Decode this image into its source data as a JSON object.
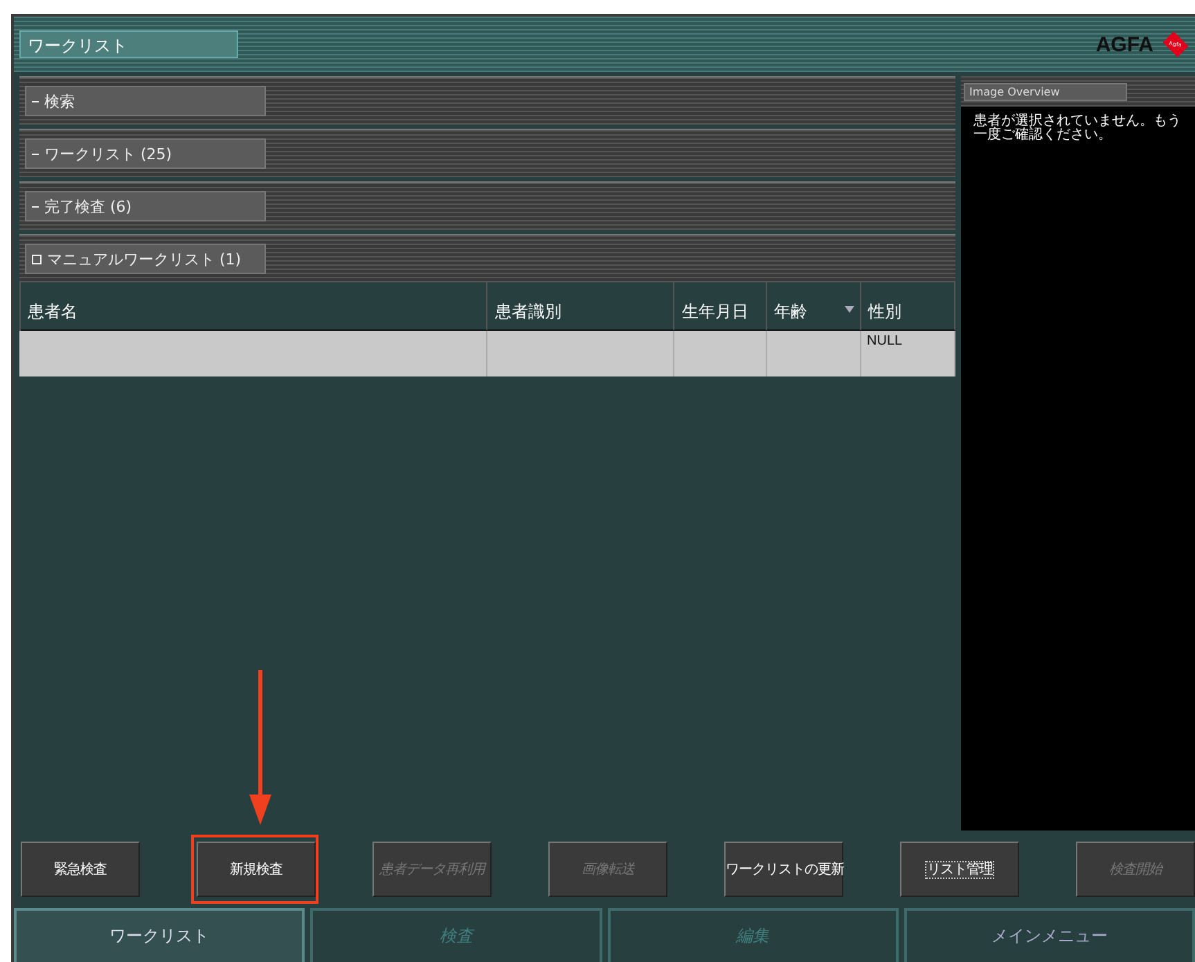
{
  "window": {
    "title": "ワークリスト",
    "logo": "AGFA",
    "logo_badge": "Agfa"
  },
  "sections": [
    {
      "label": "検索",
      "expanded": true
    },
    {
      "label": "ワークリスト (25)",
      "expanded": true
    },
    {
      "label": "完了検査 (6)",
      "expanded": true
    },
    {
      "label": "マニュアルワークリスト (1)",
      "expanded": false
    }
  ],
  "table": {
    "columns": [
      {
        "label": "患者名",
        "sorted": false
      },
      {
        "label": "患者識別",
        "sorted": false
      },
      {
        "label": "生年月日",
        "sorted": false
      },
      {
        "label": "年齢",
        "sorted": true
      },
      {
        "label": "性別",
        "sorted": false
      }
    ],
    "rows": [
      {
        "cells": [
          null,
          null,
          null,
          null,
          "NULL"
        ]
      }
    ]
  },
  "image_overview": {
    "title": "Image Overview",
    "message": "患者が選択されていません。もう一度ご確認ください。"
  },
  "buttons": [
    {
      "label": "緊急検査",
      "disabled": false,
      "highlighted": false,
      "focused": false
    },
    {
      "label": "新規検査",
      "disabled": false,
      "highlighted": true,
      "focused": false
    },
    {
      "label": "患者データ再利用",
      "disabled": true,
      "highlighted": false,
      "focused": false
    },
    {
      "label": "画像転送",
      "disabled": true,
      "highlighted": false,
      "focused": false
    },
    {
      "label": "ワークリストの更新",
      "disabled": false,
      "highlighted": false,
      "focused": false
    },
    {
      "label": "リスト管理",
      "disabled": false,
      "highlighted": false,
      "focused": true
    },
    {
      "label": "検査開始",
      "disabled": true,
      "highlighted": false,
      "focused": false
    }
  ],
  "tabs": [
    {
      "label": "ワークリスト",
      "selected": true,
      "disabled": false
    },
    {
      "label": "検査",
      "selected": false,
      "disabled": true
    },
    {
      "label": "編集",
      "selected": false,
      "disabled": true
    },
    {
      "label": "メインメニュー",
      "selected": false,
      "disabled": false
    }
  ]
}
